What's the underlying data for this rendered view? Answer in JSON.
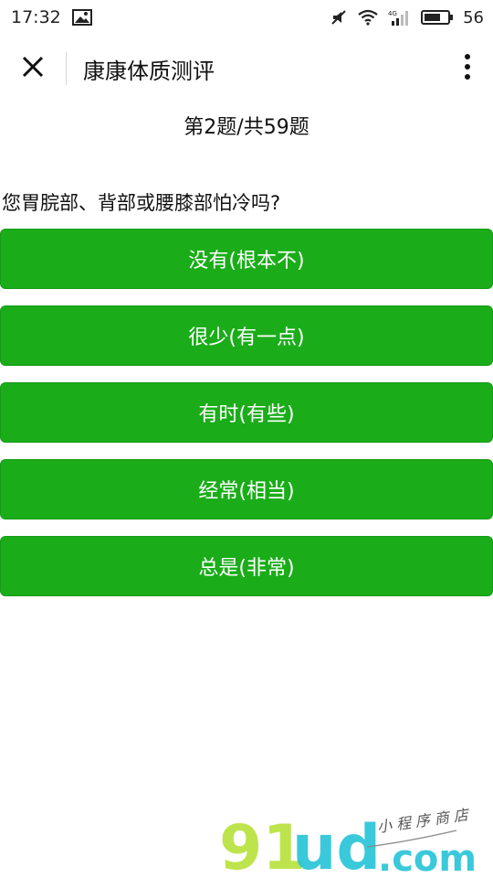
{
  "status_bar": {
    "time": "17:32",
    "battery_level": "56",
    "icons": [
      "image-icon",
      "mute-icon",
      "wifi-icon",
      "signal-4g-icon",
      "battery-icon"
    ]
  },
  "nav": {
    "title": "康康体质测评",
    "close_icon": "close-icon",
    "more_icon": "more-vertical-icon"
  },
  "progress": {
    "text": "第2题/共59题"
  },
  "question": {
    "text": "您胃脘部、背部或腰膝部怕冷吗?"
  },
  "options": [
    {
      "label": "没有(根本不)"
    },
    {
      "label": "很少(有一点)"
    },
    {
      "label": "有时(有些)"
    },
    {
      "label": "经常(相当)"
    },
    {
      "label": "总是(非常)"
    }
  ],
  "watermark": {
    "brand": "91ud",
    "domain": ".com",
    "tagline": "小程序商店"
  },
  "colors": {
    "accent": "#1aad19",
    "text": "#111111",
    "background": "#ffffff"
  }
}
